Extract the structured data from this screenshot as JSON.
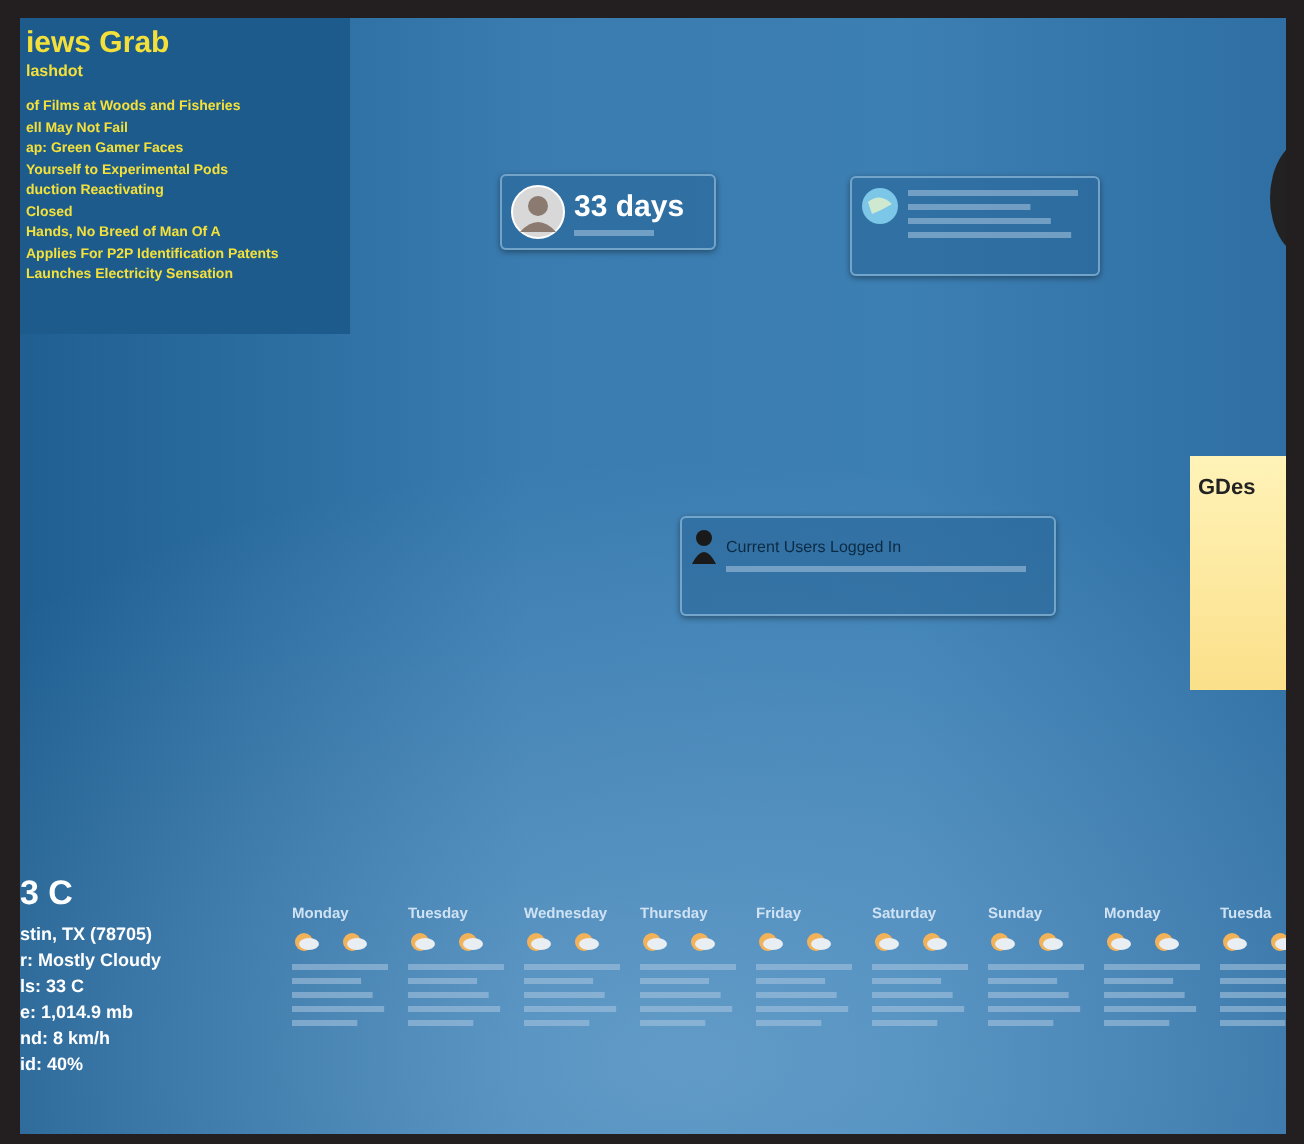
{
  "news": {
    "title": "iews Grab",
    "subtitle": "lashdot",
    "lines": [
      "of Films at Woods and Fisheries",
      "ell May Not Fail",
      "ap: Green Gamer Faces",
      "Yourself to Experimental Pods",
      "duction Reactivating",
      "Closed",
      "Hands, No Breed of Man Of A",
      "Applies For P2P Identification Patents",
      "Launches Electricity Sensation"
    ]
  },
  "countdown": {
    "value": "33 days"
  },
  "status_widget": {
    "title": "Current Users Logged In"
  },
  "sticky_note": {
    "text": "GDes"
  },
  "weather": {
    "temperature": "3 C",
    "lines": [
      "stin, TX (78705)",
      "r: Mostly Cloudy",
      "ls: 33 C",
      "e: 1,014.9 mb",
      "nd: 8 km/h",
      "id: 40%"
    ]
  },
  "forecast": [
    {
      "day": "Monday"
    },
    {
      "day": "Tuesday"
    },
    {
      "day": "Wednesday"
    },
    {
      "day": "Thursday"
    },
    {
      "day": "Friday"
    },
    {
      "day": "Saturday"
    },
    {
      "day": "Sunday"
    },
    {
      "day": "Monday"
    },
    {
      "day": "Tuesda"
    }
  ]
}
